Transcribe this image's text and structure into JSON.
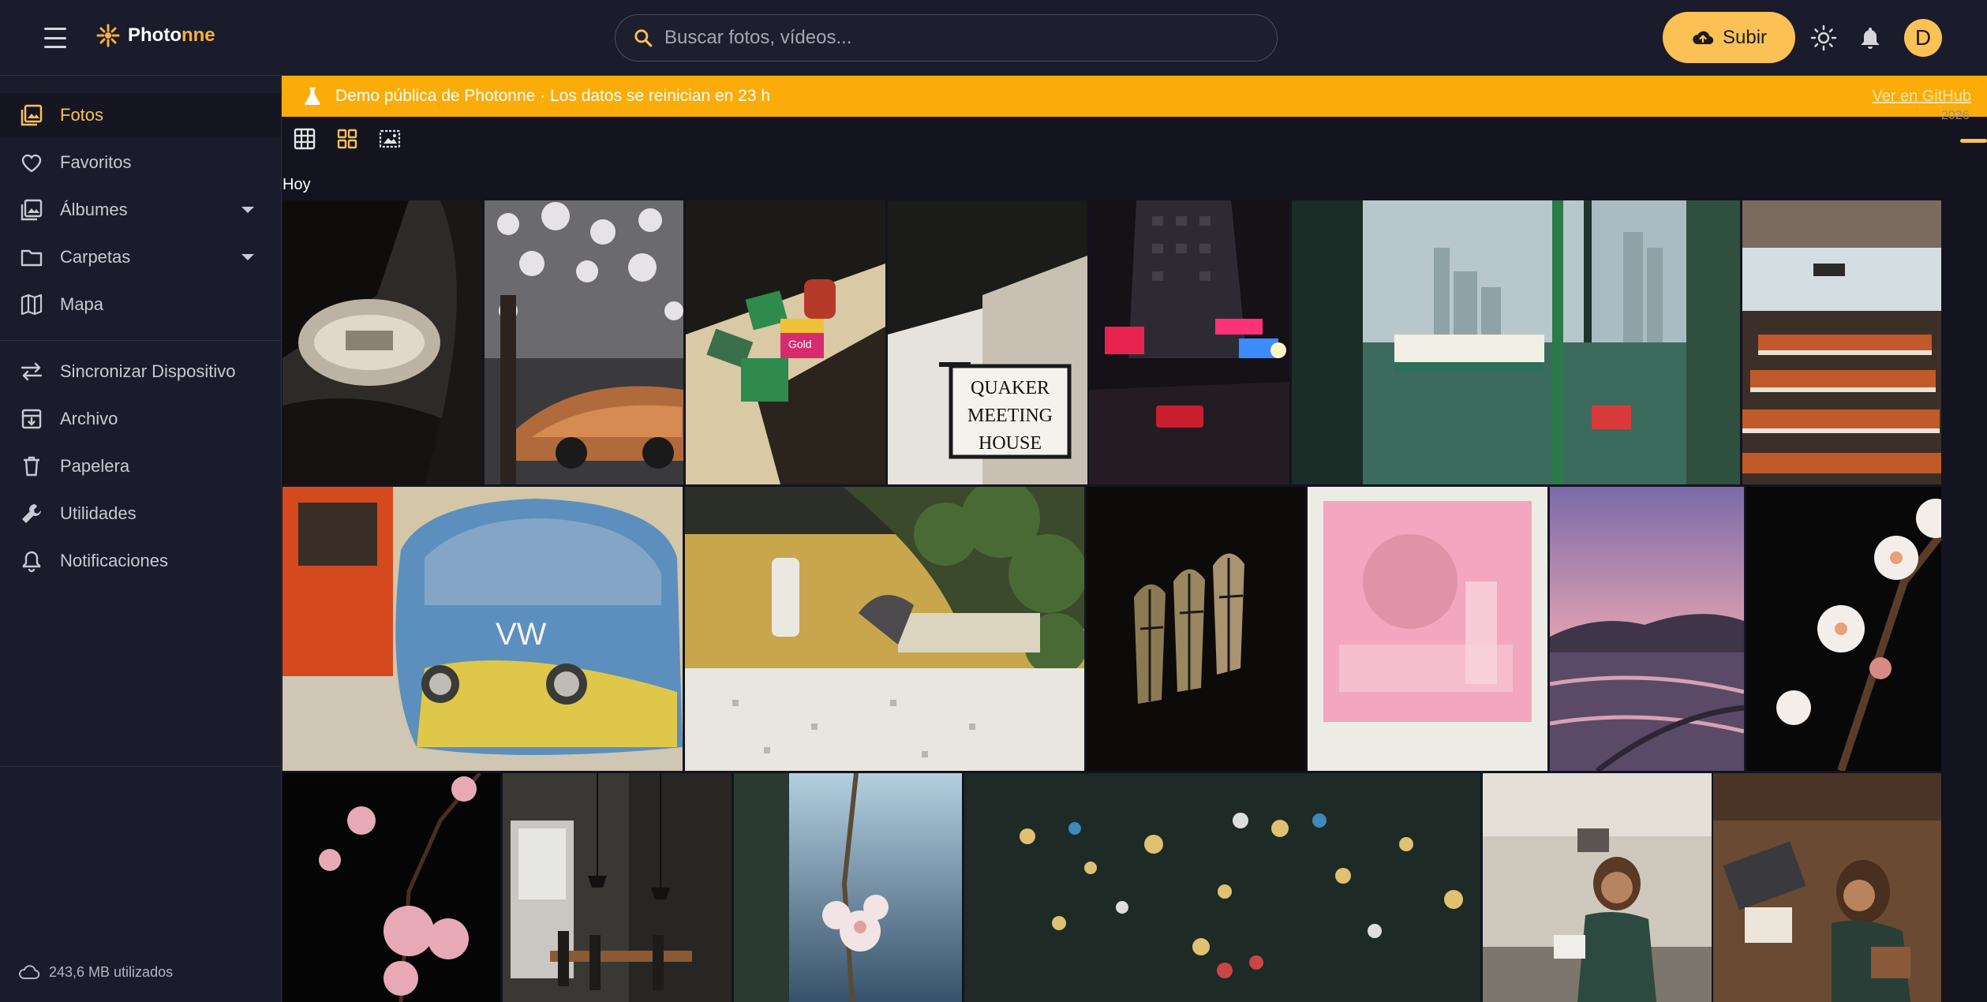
{
  "app": {
    "name_part1": "Photo",
    "name_part2": "nne"
  },
  "search": {
    "placeholder": "Buscar fotos, vídeos..."
  },
  "header": {
    "upload_label": "Subir",
    "avatar_initial": "D"
  },
  "sidebar": {
    "items": [
      {
        "label": "Fotos",
        "icon": "photos-icon",
        "active": true
      },
      {
        "label": "Favoritos",
        "icon": "heart-icon"
      },
      {
        "label": "Álbumes",
        "icon": "albums-icon",
        "expandable": true
      },
      {
        "label": "Carpetas",
        "icon": "folder-icon",
        "expandable": true
      },
      {
        "label": "Mapa",
        "icon": "map-icon"
      },
      {
        "label": "Sincronizar Dispositivo",
        "icon": "sync-icon"
      },
      {
        "label": "Archivo",
        "icon": "archive-icon"
      },
      {
        "label": "Papelera",
        "icon": "trash-icon"
      },
      {
        "label": "Utilidades",
        "icon": "wrench-icon"
      },
      {
        "label": "Notificaciones",
        "icon": "bell-outline-icon"
      }
    ],
    "storage": "243,6 MB utilizados"
  },
  "banner": {
    "text": "Demo pública de Photonne · Los datos se reinician en 23 h",
    "link": "Ver en GitHub"
  },
  "timeline": {
    "year": "2026"
  },
  "gallery": {
    "date_group": "Hoy",
    "photos": [
      {
        "name": "car-dashboard",
        "sign": ""
      },
      {
        "name": "porsche-tree",
        "sign": ""
      },
      {
        "name": "film-rolls",
        "label": "Gold"
      },
      {
        "name": "quaker-sign",
        "label": "QUAKER MEETING HOUSE"
      },
      {
        "name": "neon-street",
        "label": ""
      },
      {
        "name": "ferry-window",
        "label": ""
      },
      {
        "name": "ferry-interior",
        "label": ""
      },
      {
        "name": "vw-bus",
        "label": ""
      },
      {
        "name": "courtyard-bench",
        "label": ""
      },
      {
        "name": "church-window",
        "label": ""
      },
      {
        "name": "pink-polaroid",
        "label": ""
      },
      {
        "name": "sunset-fields",
        "label": ""
      },
      {
        "name": "white-blossom",
        "label": ""
      },
      {
        "name": "pink-blossom",
        "label": ""
      },
      {
        "name": "cafe-interior",
        "label": ""
      },
      {
        "name": "blossom-sky",
        "label": ""
      },
      {
        "name": "bokeh-lights",
        "label": ""
      },
      {
        "name": "woman-kitchen",
        "label": ""
      },
      {
        "name": "woman-desk",
        "label": ""
      }
    ]
  },
  "colors": {
    "accent": "#fbc155",
    "banner": "#fbac08",
    "background": "#13141f",
    "surface": "#1b1c2b"
  }
}
